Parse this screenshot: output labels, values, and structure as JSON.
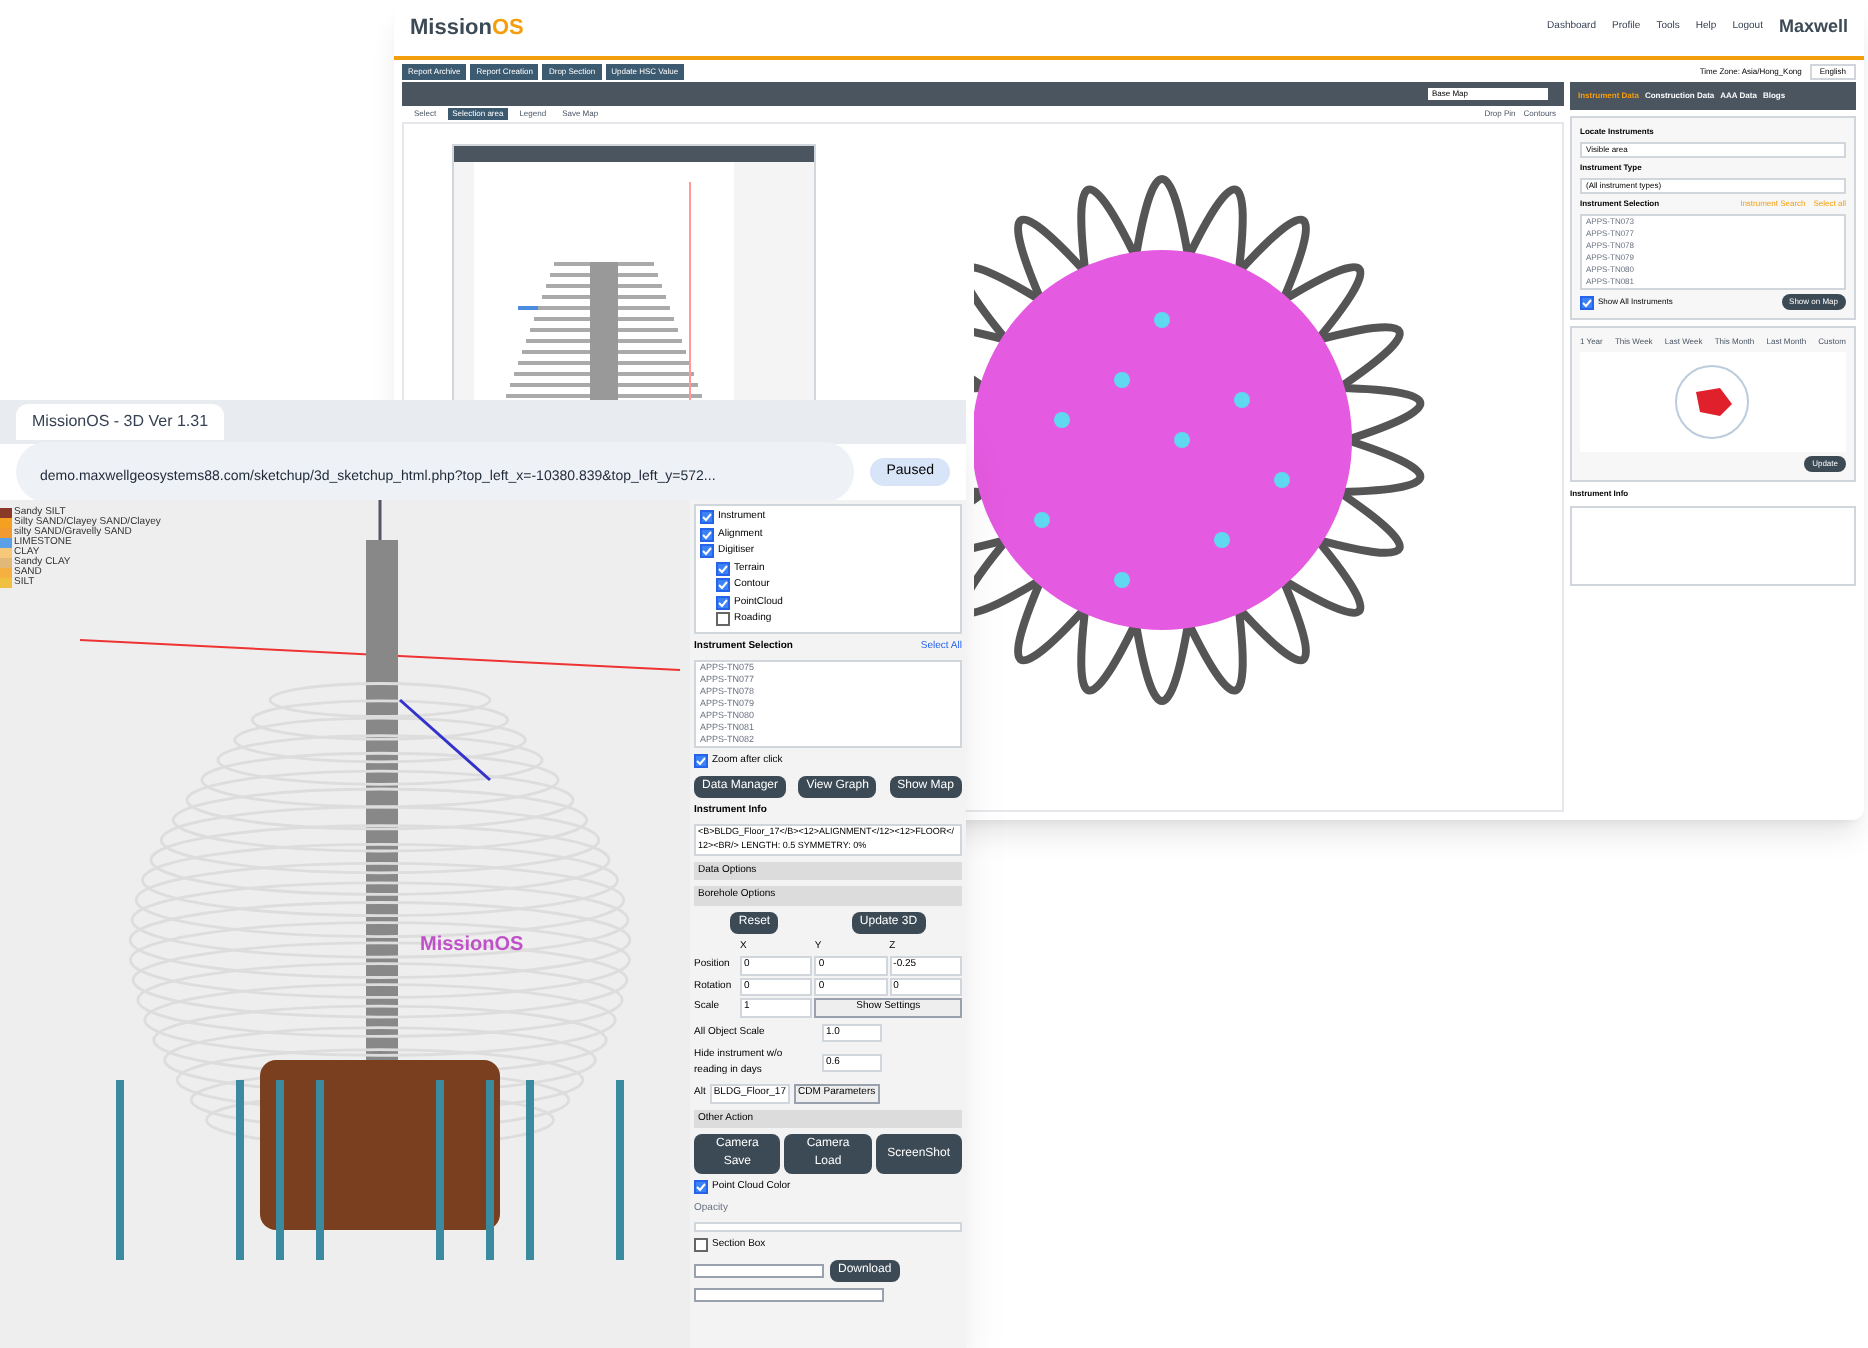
{
  "back_window": {
    "logo": {
      "part_1": "Mission",
      "part_2": "OS"
    },
    "nav": [
      "Dashboard",
      "Profile",
      "Tools",
      "Help",
      "Logout"
    ],
    "brand": "Maxwell",
    "report_tabs": [
      "Report Archive",
      "Report Creation",
      "Drop Section",
      "Update HSC Value"
    ],
    "time_zone": "Time Zone: Asia/Hong_Kong",
    "language": "English",
    "base_map": "Base Map",
    "map_tools": [
      {
        "label": "Select",
        "selected": false
      },
      {
        "label": "Selection area",
        "selected": true
      },
      {
        "label": "Legend",
        "selected": false
      },
      {
        "label": "Save Map",
        "selected": false
      }
    ],
    "map_options": [
      "Drop Pin",
      "Contours"
    ],
    "side_tabs": [
      {
        "label": "Instrument Data",
        "selected": true
      },
      {
        "label": "Construction Data",
        "selected": false
      },
      {
        "label": "AAA Data",
        "selected": false
      },
      {
        "label": "Blogs",
        "selected": false
      }
    ],
    "locate_title": "Locate Instruments",
    "locate_field": "Visible area",
    "type_title": "Instrument Type",
    "type_field": "(All instrument types)",
    "selection_title": "Instrument Selection",
    "selection_links": [
      "Instrument Search",
      "Select all"
    ],
    "instruments": [
      "APPS-TN073",
      "APPS-TN077",
      "APPS-TN078",
      "APPS-TN079",
      "APPS-TN080",
      "APPS-TN081"
    ],
    "show_all": {
      "label": "Show All Instruments",
      "checked": true
    },
    "show_button": "Show on Map",
    "period_tabs": [
      "1 Year",
      "This Week",
      "Last Week",
      "This Month",
      "Last Month",
      "Custom"
    ],
    "rose_button": "Update",
    "info_title": "Instrument Info"
  },
  "front_window": {
    "tab_title": "MissionOS - 3D Ver 1.31",
    "url": "demo.maxwellgeosystems88.com/sketchup/3d_sketchup_html.php?top_left_x=-10380.839&top_left_y=572...",
    "profile_status": "Paused",
    "legend": [
      {
        "label": "Sandy SILT",
        "color": "#8b3a2a"
      },
      {
        "label": "Silty SAND/Clayey SAND/Clayey",
        "color": "#f5a020"
      },
      {
        "label": "silty SAND/Gravelly SAND",
        "color": "#f09a30"
      },
      {
        "label": "LIMESTONE",
        "color": "#5aa0e6"
      },
      {
        "label": "CLAY",
        "color": "#f7c87a"
      },
      {
        "label": "Sandy CLAY",
        "color": "#e2b878"
      },
      {
        "label": "SAND",
        "color": "#f5b040"
      },
      {
        "label": "SILT",
        "color": "#f0c040"
      }
    ],
    "model_label": "MissionOS",
    "layers": [
      {
        "label": "Instrument",
        "checked": true
      },
      {
        "label": "Alignment",
        "checked": true
      },
      {
        "label": "Digitiser",
        "checked": true,
        "children": [
          {
            "label": "Terrain",
            "checked": true
          },
          {
            "label": "Contour",
            "checked": true
          },
          {
            "label": "PointCloud",
            "checked": true
          },
          {
            "label": "Roading",
            "checked": false
          }
        ]
      }
    ],
    "selection_title": "Instrument Selection",
    "select_all": "Select All",
    "instruments": [
      "APPS-TN075",
      "APPS-TN077",
      "APPS-TN078",
      "APPS-TN079",
      "APPS-TN080",
      "APPS-TN081",
      "APPS-TN082"
    ],
    "zoom_after_click": {
      "label": "Zoom after click",
      "checked": true
    },
    "actions": [
      "Data Manager",
      "View Graph",
      "Show Map"
    ],
    "info_title": "Instrument Info",
    "info_text": "<B>BLDG_Floor_17</B><12>ALIGNMENT</12><12>FLOOR</12><BR/> LENGTH: 0.5 SYMMETRY: 0%",
    "sections": [
      "Data Options",
      "Borehole Options"
    ],
    "borehole_buttons": [
      "Reset",
      "Update 3D"
    ],
    "axes": [
      "X",
      "Y",
      "Z"
    ],
    "rows": [
      {
        "label": "Position",
        "values": [
          "0",
          "0",
          "-0.25"
        ]
      },
      {
        "label": "Rotation",
        "values": [
          "0",
          "0",
          "0"
        ]
      }
    ],
    "scale": {
      "label": "Scale",
      "value": "1",
      "button": "Show Settings"
    },
    "all_scale": {
      "label": "All Object Scale",
      "value": "1.0"
    },
    "hide_days": {
      "label": "Hide instrument w/o reading in days",
      "value": "0.6"
    },
    "alt": {
      "label": "Alt",
      "value": "BLDG_Floor_17",
      "button": "CDM Parameters"
    },
    "other_title": "Other Action",
    "other_buttons": [
      "Camera Save",
      "Camera Load",
      "ScreenShot"
    ],
    "point_cloud": {
      "label": "Point Cloud Color",
      "checked": true
    },
    "opacity": {
      "label": "Opacity"
    },
    "section_box": {
      "label": "Section Box",
      "checked": false
    },
    "download": "Download"
  }
}
